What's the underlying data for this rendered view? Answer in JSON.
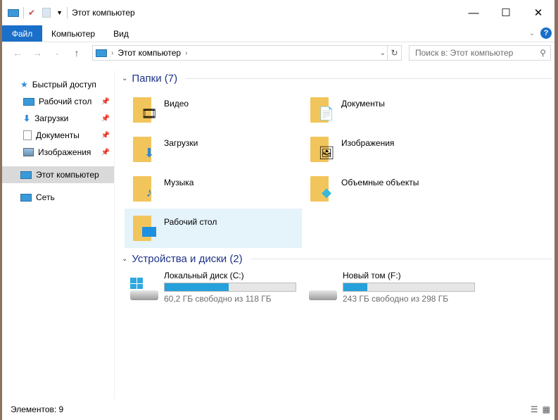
{
  "title": "Этот компьютер",
  "ribbon": {
    "tabs": [
      "Файл",
      "Компьютер",
      "Вид"
    ]
  },
  "address": {
    "path": "Этот компьютер",
    "search_placeholder": "Поиск в: Этот компьютер"
  },
  "sidebar": {
    "quick_access": "Быстрый доступ",
    "pinned": [
      "Рабочий стол",
      "Загрузки",
      "Документы",
      "Изображения"
    ],
    "this_pc": "Этот компьютер",
    "network": "Сеть"
  },
  "folders": {
    "header": "Папки (7)",
    "items": [
      "Видео",
      "Документы",
      "Загрузки",
      "Изображения",
      "Музыка",
      "Объемные объекты",
      "Рабочий стол"
    ]
  },
  "drives": {
    "header": "Устройства и диски (2)",
    "items": [
      {
        "name": "Локальный диск (C:)",
        "info": "60,2 ГБ свободно из 118 ГБ",
        "used_fraction": 0.49
      },
      {
        "name": "Новый том (F:)",
        "info": "243 ГБ свободно из 298 ГБ",
        "used_fraction": 0.185
      }
    ]
  },
  "status": {
    "count": "Элементов: 9"
  }
}
